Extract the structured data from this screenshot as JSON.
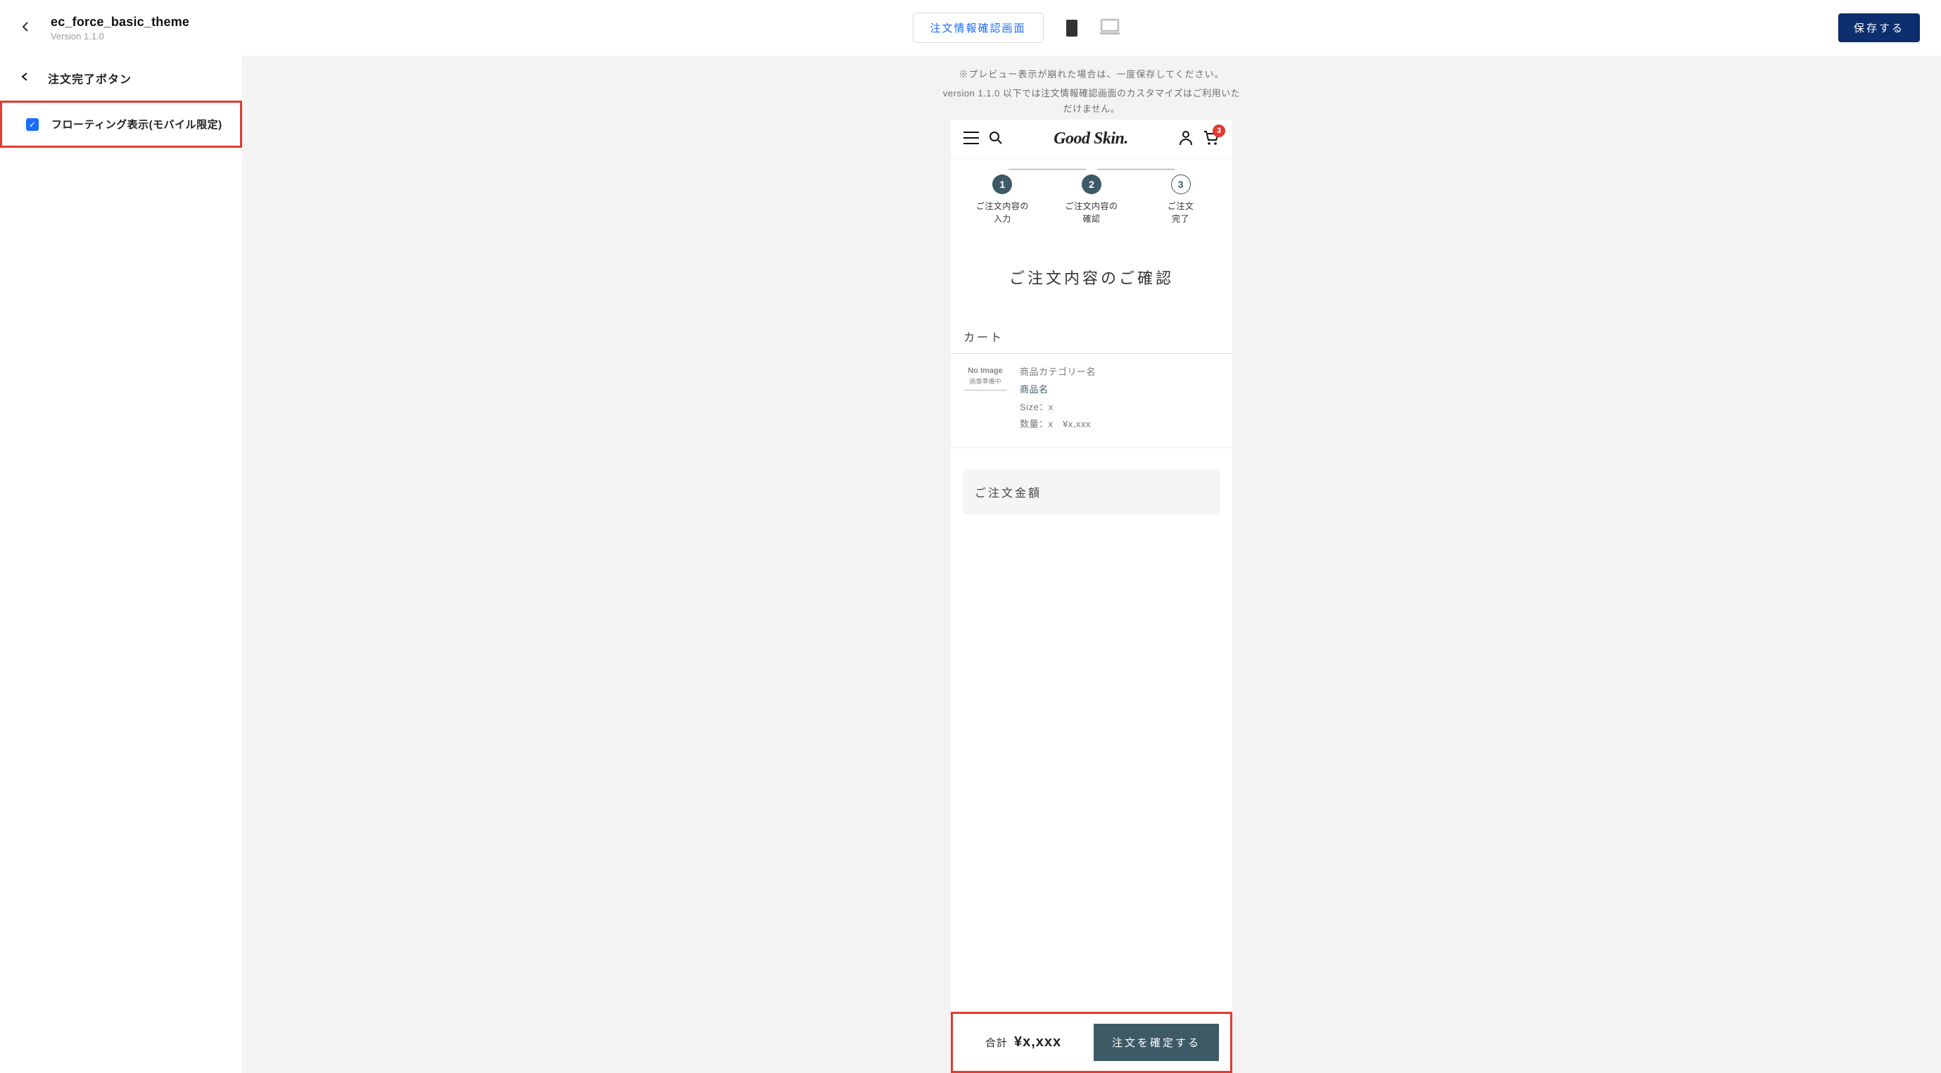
{
  "header": {
    "theme_name": "ec_force_basic_theme",
    "version": "Version 1.1.0",
    "center_button": "注文情報確認画面",
    "save_button": "保存する"
  },
  "sidebar": {
    "section_title": "注文完了ボタン",
    "option_label": "フローティング表示(モバイル限定)",
    "option_checked": true
  },
  "canvas": {
    "hint1": "※プレビュー表示が崩れた場合は、一度保存してください。",
    "hint2_line1": "version 1.1.0 以下では注文情報確認画面のカスタマイズはご利用いた",
    "hint2_line2": "だけません。"
  },
  "preview": {
    "brand": "Good Skin.",
    "cart_badge": "3",
    "steps": [
      {
        "num": "1",
        "label_l1": "ご注文内容の",
        "label_l2": "入力",
        "style": "filled"
      },
      {
        "num": "2",
        "label_l1": "ご注文内容の",
        "label_l2": "確認",
        "style": "filled"
      },
      {
        "num": "3",
        "label_l1": "ご注文",
        "label_l2": "完了",
        "style": "outline"
      }
    ],
    "page_title": "ご注文内容のご確認",
    "cart_label": "カート",
    "noimage_t1": "No Image",
    "noimage_t2": "画像準備中",
    "item": {
      "category": "商品カテゴリー名",
      "name": "商品名",
      "size": "Size：x",
      "qty_price": "数量：x　¥x,xxx"
    },
    "amount_label": "ご注文金額",
    "floating": {
      "total_prefix": "合計",
      "total_value": "¥x,xxx",
      "confirm": "注文を確定する"
    }
  }
}
